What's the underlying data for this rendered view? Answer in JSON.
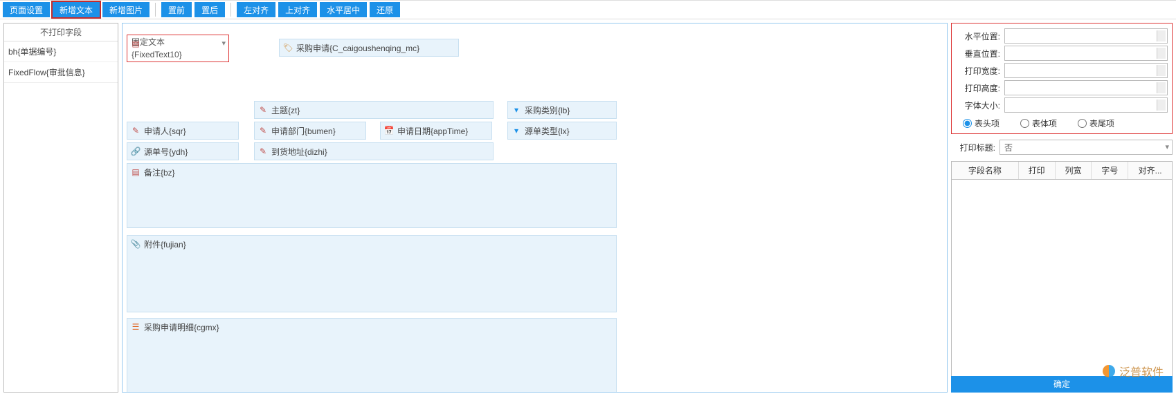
{
  "toolbar": {
    "page_settings": "页面设置",
    "add_text": "新增文本",
    "add_image": "新增图片",
    "bring_front": "置前",
    "send_back": "置后",
    "align_left": "左对齐",
    "align_top": "上对齐",
    "center_h": "水平居中",
    "restore": "还原"
  },
  "left_panel": {
    "title": "不打印字段",
    "items": [
      "bh{单据编号}",
      "FixedFlow{审批信息}"
    ]
  },
  "canvas_fields": {
    "fixed_text": "固定文本\n{FixedText10}",
    "title_field": "采购申请{C_caigoushenqing_mc}",
    "subject": "主题{zt}",
    "purchase_type": "采购类别{lb}",
    "applicant": "申请人{sqr}",
    "apply_dept": "申请部门{bumen}",
    "apply_date": "申请日期{appTime}",
    "src_type": "源单类型{lx}",
    "src_no": "源单号{ydh}",
    "arrive_addr": "到货地址{dizhi}",
    "remark": "备注{bz}",
    "attachment": "附件{fujian}",
    "detail": "采购申请明细{cgmx}"
  },
  "right_panel": {
    "props": {
      "hpos": "水平位置:",
      "vpos": "垂直位置:",
      "pwidth": "打印宽度:",
      "pheight": "打印高度:",
      "fontsize": "字体大小:"
    },
    "radios": {
      "head": "表头项",
      "body": "表体项",
      "tail": "表尾项"
    },
    "print_title_label": "打印标题:",
    "print_title_value": "否",
    "grid_headers": {
      "name": "字段名称",
      "print": "打印",
      "colw": "列宽",
      "font": "字号",
      "align": "对齐..."
    },
    "ok": "确定"
  },
  "watermark": "泛普软件"
}
